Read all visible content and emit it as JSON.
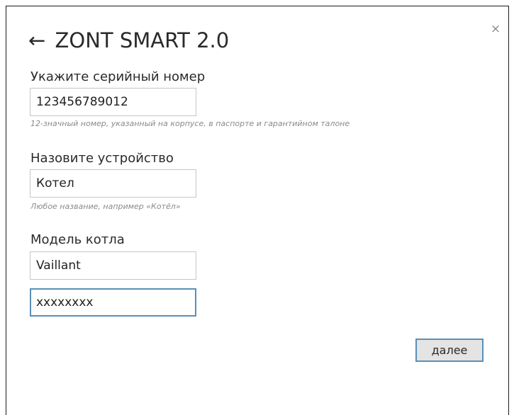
{
  "dialog": {
    "back_icon": "←",
    "title": "ZONT SMART 2.0",
    "close_icon": "×"
  },
  "serial": {
    "label": "Укажите серийный номер",
    "value": "123456789012",
    "hint": "12-значный номер, указанный на корпусе, в паспорте и гарантийном талоне"
  },
  "device_name": {
    "label": "Назовите устройство",
    "value": "Котел",
    "hint": "Любое название, например «Котёл»"
  },
  "boiler_model": {
    "label": "Модель котла",
    "brand_value": "Vaillant",
    "model_value": "xxxxxxxx"
  },
  "actions": {
    "next_label": "далее"
  },
  "colors": {
    "focus_accent": "#5a8fb8",
    "button_bg": "#e4e4e4",
    "hint_text": "#8a8a8a"
  }
}
